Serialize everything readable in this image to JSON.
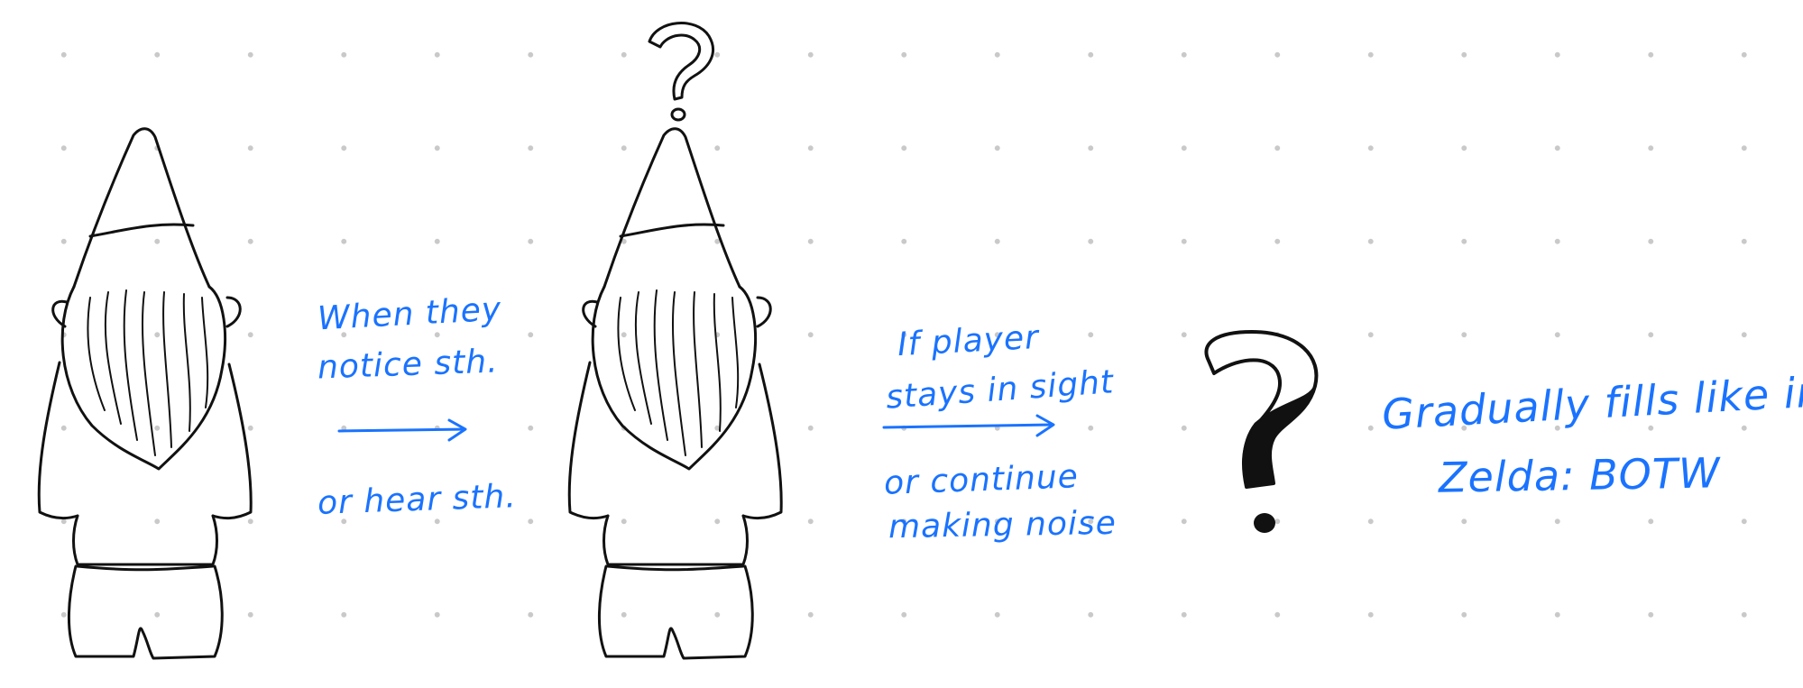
{
  "colors": {
    "ink": "#111111",
    "annotation": "#1a73ff",
    "dot_grid": "#c9c9c9",
    "background": "#ffffff"
  },
  "figures": [
    {
      "name": "gnome-idle",
      "depicts": "garden gnome seen from behind"
    },
    {
      "name": "gnome-suspicious",
      "depicts": "garden gnome seen from behind with question mark outline above"
    },
    {
      "name": "filled-question-mark",
      "depicts": "large question mark filling with black ink"
    }
  ],
  "annotations": {
    "step1": {
      "line1": "When they",
      "line2": "notice sth.",
      "line3": "or hear sth."
    },
    "step2": {
      "line1": "If player",
      "line2": "stays in sight",
      "line3": "or continue",
      "line4": "making noise"
    },
    "step3": {
      "line1": "Gradually fills like in",
      "line2": "Zelda: BOTW"
    }
  }
}
